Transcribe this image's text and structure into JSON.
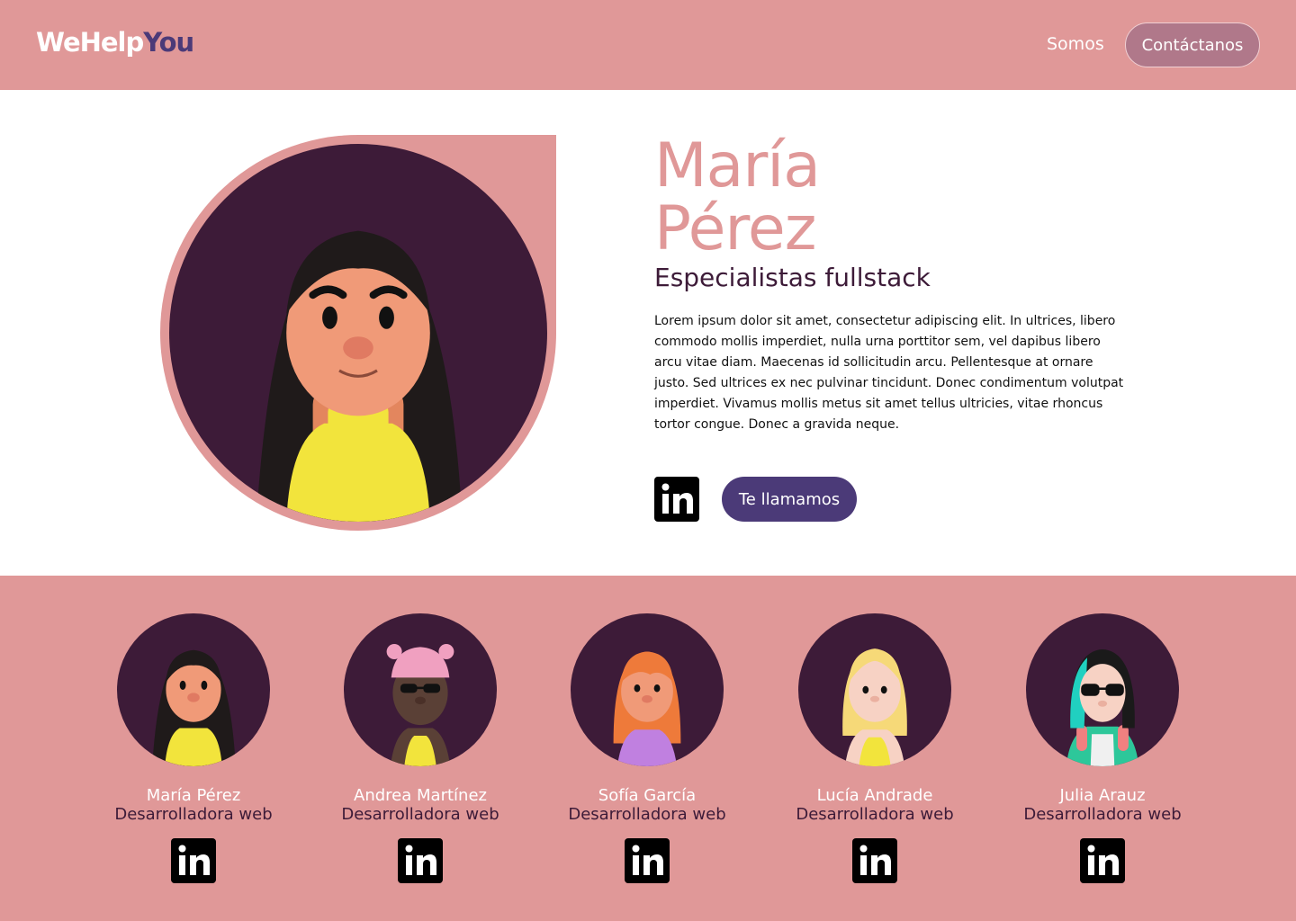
{
  "header": {
    "logo_part1": "WeHelp",
    "logo_part2": "You",
    "nav_somos": "Somos",
    "contact_button": "Contáctanos"
  },
  "hero": {
    "name_line1": "María",
    "name_line2": "Pérez",
    "role": "Especialistas fullstack",
    "description": "Lorem ipsum dolor sit amet, consectetur adipiscing elit. In ultrices, libero commodo mollis imperdiet, nulla urna porttitor sem, vel dapibus libero arcu vitae diam. Maecenas id sollicitudin arcu. Pellentesque at ornare justo. Sed ultrices ex nec pulvinar tincidunt. Donec condimentum volutpat imperdiet. Vivamus mollis metus sit amet tellus ultricies, vitae rhoncus tortor congue. Donec a gravida neque.",
    "linkedin_icon": "linkedin-icon",
    "call_button": "Te llamamos"
  },
  "team": [
    {
      "name": "María Pérez",
      "role": "Desarrolladora web",
      "icon": "linkedin-icon"
    },
    {
      "name": "Andrea Martínez",
      "role": "Desarrolladora web",
      "icon": "linkedin-icon"
    },
    {
      "name": "Sofía García",
      "role": "Desarrolladora web",
      "icon": "linkedin-icon"
    },
    {
      "name": "Lucía Andrade",
      "role": "Desarrolladora web",
      "icon": "linkedin-icon"
    },
    {
      "name": "Julia Arauz",
      "role": "Desarrolladora web",
      "icon": "linkedin-icon"
    }
  ],
  "colors": {
    "brand_pink": "#e09898",
    "brand_purple": "#4b3a78",
    "avatar_bg": "#3d1b38",
    "contact_button_bg": "#b0788a"
  }
}
